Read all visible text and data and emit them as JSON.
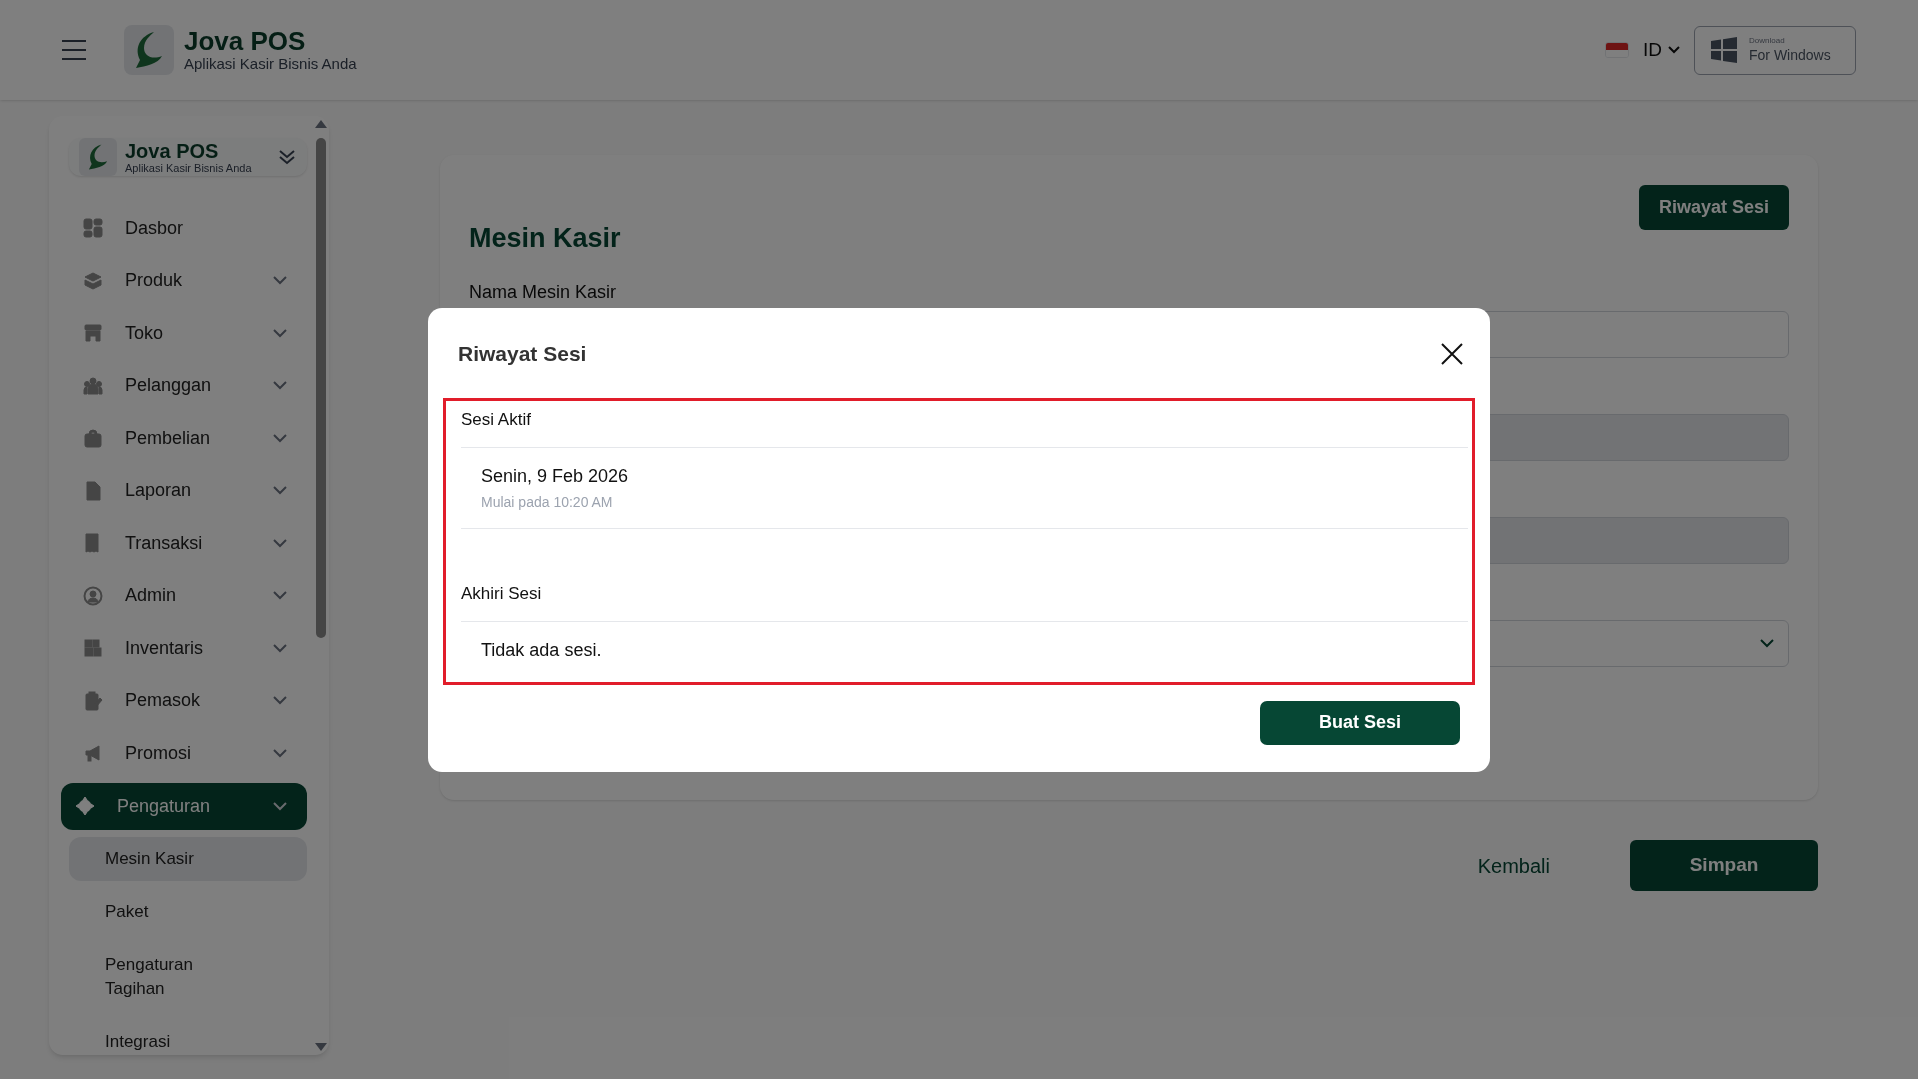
{
  "header": {
    "brand_name": "Jova POS",
    "brand_tagline": "Aplikasi Kasir Bisnis Anda",
    "language": "ID",
    "download": {
      "small": "Download",
      "main": "For Windows"
    }
  },
  "sidebar": {
    "brand_name": "Jova POS",
    "brand_tagline": "Aplikasi Kasir Bisnis Anda",
    "items": [
      {
        "label": "Dasbor",
        "has_submenu": false,
        "selected": false
      },
      {
        "label": "Produk",
        "has_submenu": true,
        "selected": false
      },
      {
        "label": "Toko",
        "has_submenu": true,
        "selected": false
      },
      {
        "label": "Pelanggan",
        "has_submenu": true,
        "selected": false
      },
      {
        "label": "Pembelian",
        "has_submenu": true,
        "selected": false
      },
      {
        "label": "Laporan",
        "has_submenu": true,
        "selected": false
      },
      {
        "label": "Transaksi",
        "has_submenu": true,
        "selected": false
      },
      {
        "label": "Admin",
        "has_submenu": true,
        "selected": false
      },
      {
        "label": "Inventaris",
        "has_submenu": true,
        "selected": false
      },
      {
        "label": "Pemasok",
        "has_submenu": true,
        "selected": false
      },
      {
        "label": "Promosi",
        "has_submenu": true,
        "selected": false
      },
      {
        "label": "Pengaturan",
        "has_submenu": true,
        "selected": true,
        "children": [
          {
            "label": "Mesin Kasir",
            "selected": true
          },
          {
            "label": "Paket",
            "selected": false
          },
          {
            "label": "Pengaturan Tagihan",
            "selected": false
          },
          {
            "label": "Integrasi",
            "selected": false
          }
        ]
      }
    ]
  },
  "page": {
    "title": "Mesin Kasir",
    "history_button": "Riwayat Sesi",
    "fields": [
      {
        "label": "Nama Mesin Kasir",
        "kind": "text"
      },
      {
        "kind": "readonly"
      },
      {
        "kind": "readonly"
      },
      {
        "kind": "select"
      }
    ],
    "back_button": "Kembali",
    "save_button": "Simpan"
  },
  "modal": {
    "title": "Riwayat Sesi",
    "sections": [
      {
        "heading": "Sesi Aktif",
        "entries": [
          {
            "title": "Senin, 9 Feb 2026",
            "subtitle": "Mulai pada 10:20 AM"
          }
        ]
      },
      {
        "heading": "Akhiri Sesi",
        "empty_text": "Tidak ada sesi."
      }
    ],
    "highlighted": true,
    "button": "Buat Sesi"
  }
}
